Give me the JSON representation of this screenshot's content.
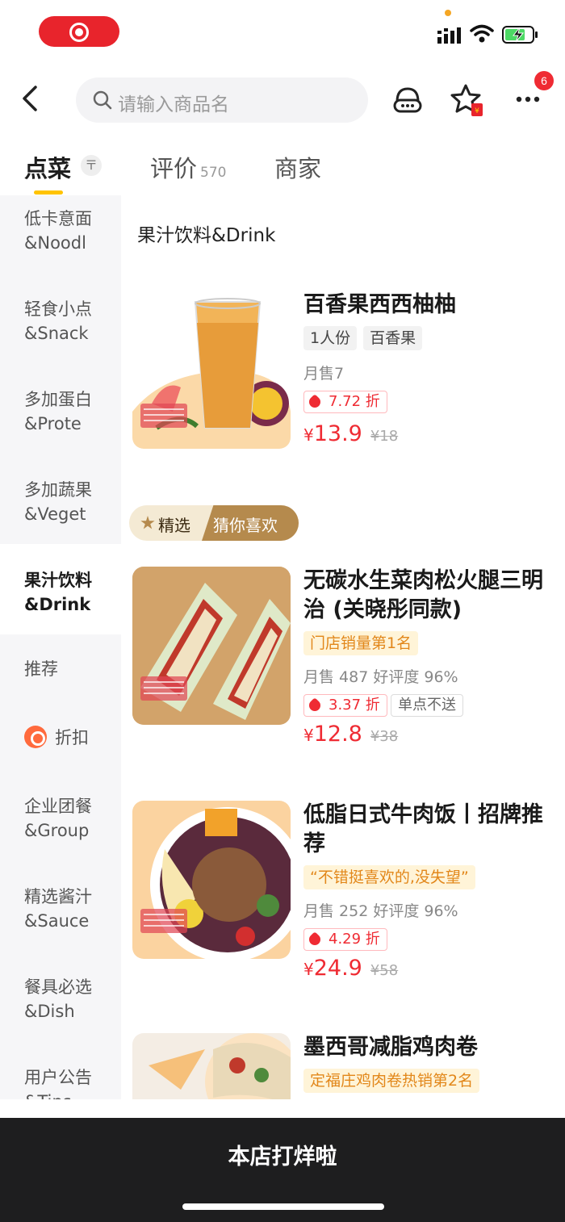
{
  "status_bar": {
    "record_indicator": "record-icon",
    "signal_icon": "signal-icon",
    "wifi_icon": "wifi-icon",
    "battery_icon": "battery-charging-icon"
  },
  "nav": {
    "search_placeholder": "请输入商品名",
    "badge_count": "6"
  },
  "tabs": [
    {
      "label": "点菜",
      "active": true
    },
    {
      "label": "评价",
      "count": "570"
    },
    {
      "label": "商家"
    }
  ],
  "tab_sort_glyph": "〒",
  "sidebar": {
    "items": [
      {
        "label": "低卡意面\n&Noodl"
      },
      {
        "label": "轻食小点\n&Snack"
      },
      {
        "label": "多加蛋白\n&Prote"
      },
      {
        "label": "多加蔬果\n&Veget"
      },
      {
        "label": "果汁饮料\n&Drink",
        "active": true
      },
      {
        "label": "推荐"
      },
      {
        "label": "折扣"
      },
      {
        "label": "企业团餐\n&Group"
      },
      {
        "label": "精选酱汁\n&Sauce"
      },
      {
        "label": "餐具必选\n&Dish"
      },
      {
        "label": "用户公告\n&Tips"
      }
    ]
  },
  "section": {
    "title": "果汁饮料&Drink"
  },
  "picked_banner": {
    "left": "精选",
    "right": "猜你喜欢"
  },
  "products": [
    {
      "name": "百香果西西柚柚",
      "tags": [
        "1人份",
        "百香果"
      ],
      "sold": "月售7",
      "discount": "7.72 折",
      "price": "13.9",
      "old_price": "¥18"
    },
    {
      "name": "无碳水生菜肉松火腿三明治 (关晓彤同款)",
      "rank": "门店销量第1名",
      "sold": "月售 487  好评度 96%",
      "discount": "3.37 折",
      "extra": "单点不送",
      "price": "12.8",
      "old_price": "¥38"
    },
    {
      "name": "低脂日式牛肉饭丨招牌推荐",
      "rank": "“不错挺喜欢的,没失望”",
      "sold": "月售 252  好评度 96%",
      "discount": "4.29 折",
      "price": "24.9",
      "old_price": "¥58"
    },
    {
      "name": "墨西哥减脂鸡肉卷",
      "rank": "定福庄鸡肉卷热销第2名"
    }
  ],
  "currency": "¥",
  "bottom_bar": {
    "label": "本店打烊啦"
  }
}
